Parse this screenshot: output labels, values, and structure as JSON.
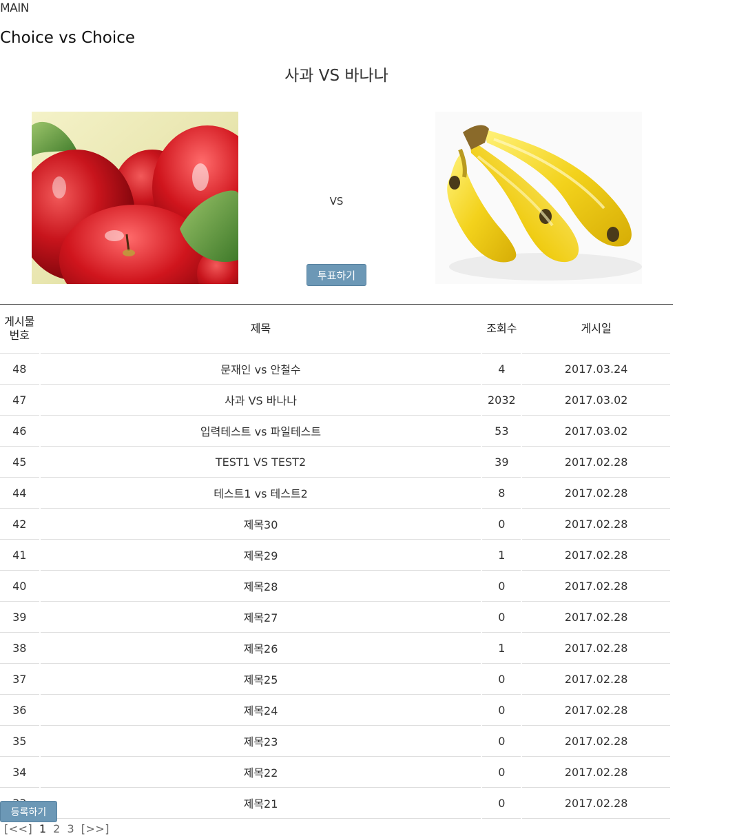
{
  "nav": {
    "main_link": "MAIN"
  },
  "site": {
    "title": "Choice vs Choice"
  },
  "matchup": {
    "title": "사과 VS 바나나",
    "vs_label": "VS",
    "vote_label": "투표하기",
    "left_image": "apples-image",
    "right_image": "bananas-image"
  },
  "board": {
    "headers": {
      "no_line1": "게시물",
      "no_line2": "번호",
      "title": "제목",
      "views": "조회수",
      "date": "게시일"
    },
    "rows": [
      {
        "no": "48",
        "title": "문재인 vs 안철수",
        "views": "4",
        "date": "2017.03.24"
      },
      {
        "no": "47",
        "title": "사과 VS 바나나",
        "views": "2032",
        "date": "2017.03.02"
      },
      {
        "no": "46",
        "title": "입력테스트 vs 파일테스트",
        "views": "53",
        "date": "2017.03.02"
      },
      {
        "no": "45",
        "title": "TEST1 VS TEST2",
        "views": "39",
        "date": "2017.02.28"
      },
      {
        "no": "44",
        "title": "테스트1 vs 테스트2",
        "views": "8",
        "date": "2017.02.28"
      },
      {
        "no": "42",
        "title": "제목30",
        "views": "0",
        "date": "2017.02.28"
      },
      {
        "no": "41",
        "title": "제목29",
        "views": "1",
        "date": "2017.02.28"
      },
      {
        "no": "40",
        "title": "제목28",
        "views": "0",
        "date": "2017.02.28"
      },
      {
        "no": "39",
        "title": "제목27",
        "views": "0",
        "date": "2017.02.28"
      },
      {
        "no": "38",
        "title": "제목26",
        "views": "1",
        "date": "2017.02.28"
      },
      {
        "no": "37",
        "title": "제목25",
        "views": "0",
        "date": "2017.02.28"
      },
      {
        "no": "36",
        "title": "제목24",
        "views": "0",
        "date": "2017.02.28"
      },
      {
        "no": "35",
        "title": "제목23",
        "views": "0",
        "date": "2017.02.28"
      },
      {
        "no": "34",
        "title": "제목22",
        "views": "0",
        "date": "2017.02.28"
      },
      {
        "no": "33",
        "title": "제목21",
        "views": "0",
        "date": "2017.02.28"
      }
    ],
    "write_label": "등록하기"
  },
  "pager": {
    "prev": "[<<]",
    "pages": [
      "1",
      "2",
      "3"
    ],
    "current": "1",
    "next": "[>>]"
  },
  "colors": {
    "button_bg": "#6c98b6",
    "rule": "#444444",
    "row_rule": "#dddddd"
  }
}
